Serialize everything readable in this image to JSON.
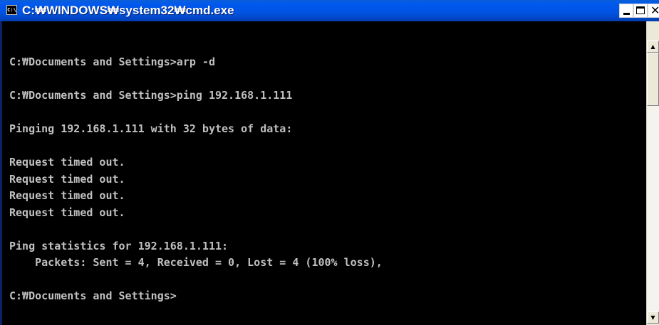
{
  "window": {
    "title": "C:₩WINDOWS₩system32₩cmd.exe",
    "icon_text": "C:\\",
    "minimize_icon": "minimize-icon",
    "maximize_icon": "maximize-icon",
    "close_icon": "close-icon",
    "close_glyph": "✕"
  },
  "console": {
    "text": "C:₩Documents and Settings>arp -d\n\nC:₩Documents and Settings>ping 192.168.1.111\n\nPinging 192.168.1.111 with 32 bytes of data:\n\nRequest timed out.\nRequest timed out.\nRequest timed out.\nRequest timed out.\n\nPing statistics for 192.168.1.111:\n    Packets: Sent = 4, Received = 0, Lost = 4 (100% loss),\n\nC:₩Documents and Settings>"
  },
  "scrollbar": {
    "up_glyph": "▲",
    "down_glyph": "▼"
  },
  "colors": {
    "titlebar": "#0054e3",
    "console_bg": "#000000",
    "console_fg": "#c0c0c0"
  }
}
